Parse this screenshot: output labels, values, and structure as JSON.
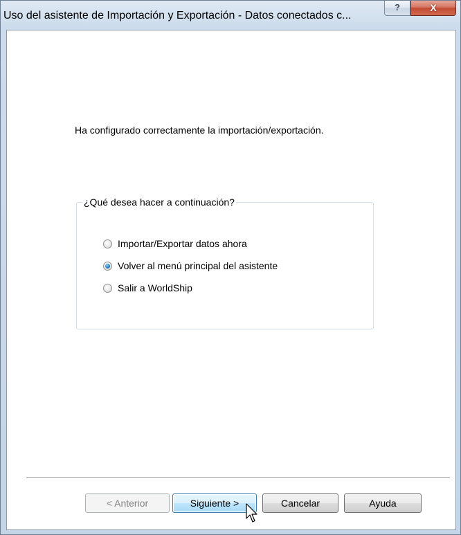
{
  "window": {
    "title": "Uso del asistente de Importación y Exportación - Datos conectados c...",
    "help_glyph": "?",
    "close_glyph": "X"
  },
  "content": {
    "success_message": "Ha configurado correctamente la importación/exportación.",
    "group": {
      "legend": "¿Qué desea hacer a continuación?",
      "options": [
        {
          "label": "Importar/Exportar datos ahora",
          "checked": false
        },
        {
          "label": "Volver al menú principal del asistente",
          "checked": true
        },
        {
          "label": "Salir a WorldShip",
          "checked": false
        }
      ]
    }
  },
  "buttons": {
    "back_label": "< Anterior",
    "next_label": "Siguiente >",
    "cancel_label": "Cancelar",
    "help_label": "Ayuda"
  },
  "icons": {
    "help": "question-mark-icon",
    "close": "close-icon",
    "cursor": "mouse-pointer-icon"
  }
}
